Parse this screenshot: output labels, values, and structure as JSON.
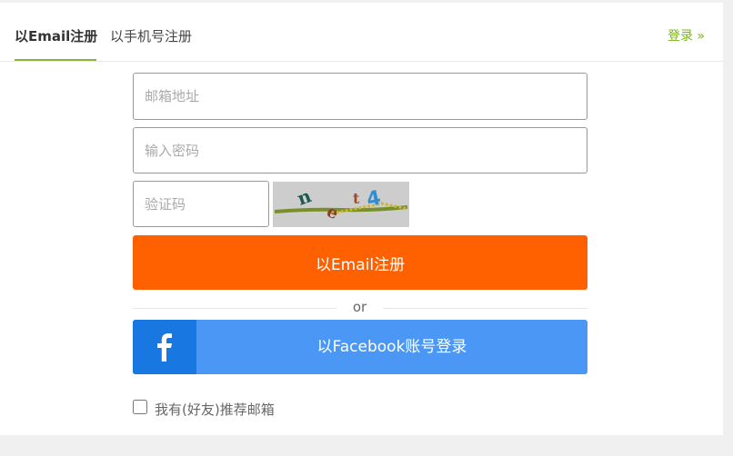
{
  "tabs": {
    "email_label": "以Email注册",
    "phone_label": "以手机号注册"
  },
  "login_link": "登录 »",
  "form": {
    "email_placeholder": "邮箱地址",
    "password_placeholder": "输入密码",
    "captcha_placeholder": "验证码",
    "captcha_text": "n e t 4",
    "register_button": "以Email注册",
    "or_text": "or",
    "facebook_button": "以Facebook账号登录",
    "facebook_icon_glyph": "f",
    "recommend_label": "我有(好友)推荐邮箱"
  },
  "colors": {
    "accent_green": "#7ab51d",
    "register_orange": "#ff6000",
    "facebook_blue": "#4a97f5",
    "facebook_dark_blue": "#1877e0"
  }
}
